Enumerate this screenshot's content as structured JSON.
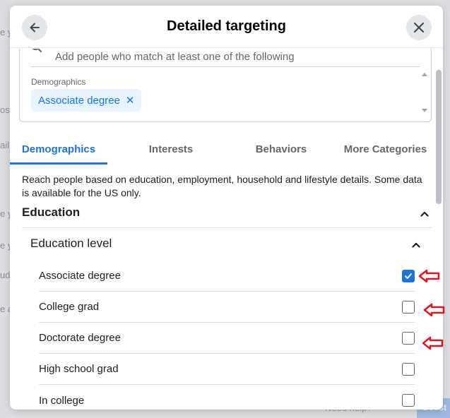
{
  "dialog": {
    "title": "Detailed targeting",
    "back_label": "Back",
    "close_label": "Close"
  },
  "selection": {
    "search_placeholder": "Add people who match at least one of the following",
    "group_label": "Demographics",
    "chips": [
      {
        "label": "Associate degree"
      }
    ]
  },
  "tabs": [
    {
      "label": "Demographics",
      "active": true
    },
    {
      "label": "Interests",
      "active": false
    },
    {
      "label": "Behaviors",
      "active": false
    },
    {
      "label": "More Categories",
      "active": false
    }
  ],
  "description": "Reach people based on education, employment, household and lifestyle details. Some data is available for the US only.",
  "section": {
    "title": "Education",
    "expanded": true,
    "subsection": {
      "title": "Education level",
      "expanded": true,
      "options": [
        {
          "label": "Associate degree",
          "checked": true
        },
        {
          "label": "College grad",
          "checked": false
        },
        {
          "label": "Doctorate degree",
          "checked": false
        },
        {
          "label": "High school grad",
          "checked": false
        },
        {
          "label": "In college",
          "checked": false
        }
      ]
    }
  },
  "background": {
    "help_label": "Need help?",
    "boost_label": "Boost"
  },
  "colors": {
    "accent": "#1b74e4",
    "chip_bg": "#e7f3ff",
    "annotation_arrow": "#e0141e"
  }
}
